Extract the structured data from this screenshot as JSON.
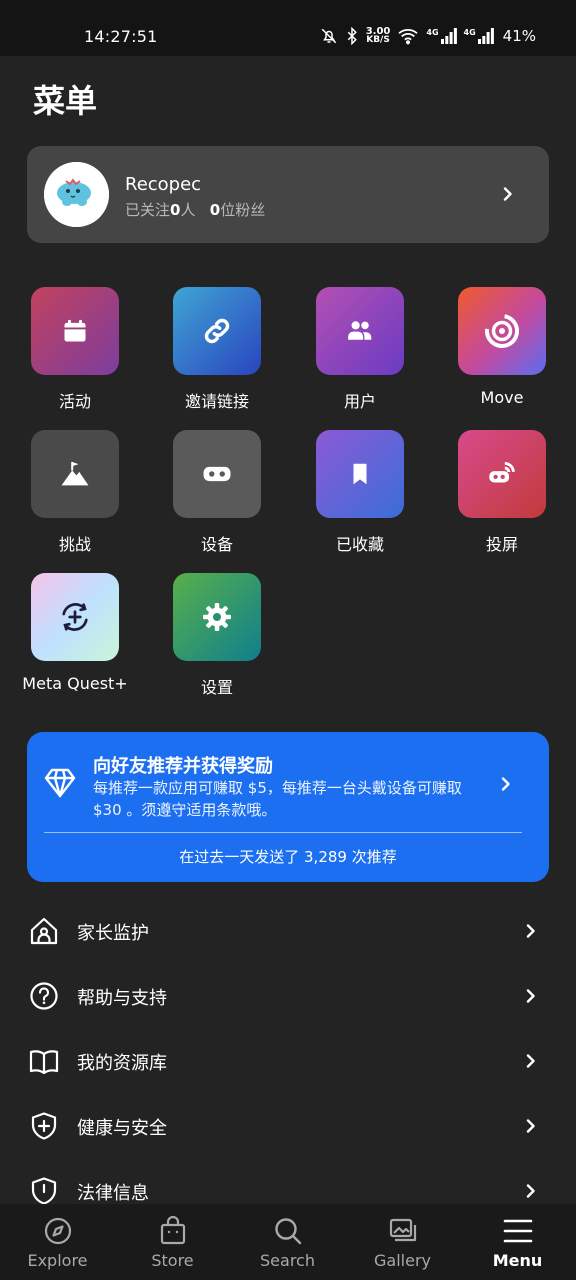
{
  "status_bar": {
    "time": "14:27:51",
    "net_speed_value": "3.00",
    "net_speed_unit": "KB/S",
    "signal_1_label": "4G",
    "signal_2_label": "4G",
    "battery": "41%"
  },
  "page_title": "菜单",
  "profile": {
    "name": "Recopec",
    "following_prefix": "已关注",
    "following_count": "0",
    "following_suffix": "人",
    "followers_count": "0",
    "followers_suffix": "位粉丝"
  },
  "tiles": [
    {
      "label": "活动",
      "icon": "calendar-icon"
    },
    {
      "label": "邀请链接",
      "icon": "link-icon"
    },
    {
      "label": "用户",
      "icon": "people-icon"
    },
    {
      "label": "Move",
      "icon": "move-ring-icon"
    },
    {
      "label": "挑战",
      "icon": "mountain-flag-icon"
    },
    {
      "label": "设备",
      "icon": "vr-headset-icon"
    },
    {
      "label": "已收藏",
      "icon": "bookmark-icon"
    },
    {
      "label": "投屏",
      "icon": "cast-headset-icon"
    },
    {
      "label": "Meta Quest+",
      "icon": "meta-quest-plus-icon"
    },
    {
      "label": "设置",
      "icon": "gear-icon"
    }
  ],
  "referral": {
    "title": "向好友推荐并获得奖励",
    "description": "每推荐一款应用可赚取 $5，每推荐一台头戴设备可赚取 $30 。须遵守适用条款哦。",
    "footer": "在过去一天发送了 3,289 次推荐"
  },
  "menu_items": [
    {
      "label": "家长监护",
      "icon": "parental-home-icon"
    },
    {
      "label": "帮助与支持",
      "icon": "help-circle-icon"
    },
    {
      "label": "我的资源库",
      "icon": "library-book-icon"
    },
    {
      "label": "健康与安全",
      "icon": "shield-plus-icon"
    },
    {
      "label": "法律信息",
      "icon": "legal-doc-icon"
    }
  ],
  "bottom_nav": [
    {
      "label": "Explore",
      "icon": "compass-icon",
      "active": false
    },
    {
      "label": "Store",
      "icon": "store-bag-icon",
      "active": false
    },
    {
      "label": "Search",
      "icon": "search-icon",
      "active": false
    },
    {
      "label": "Gallery",
      "icon": "gallery-icon",
      "active": false
    },
    {
      "label": "Menu",
      "icon": "hamburger-menu-icon",
      "active": true
    }
  ],
  "colors": {
    "background": "#232323",
    "card": "#454545",
    "referral_blue": "#1b6ff0",
    "nav_bg": "#1a1a1a"
  }
}
